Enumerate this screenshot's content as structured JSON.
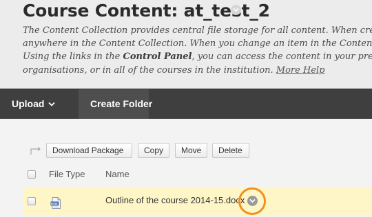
{
  "header": {
    "title": "Course Content: at_test_2",
    "description": {
      "line1": "The Content Collection provides central file storage for all content. When creating",
      "line2": "anywhere in the Content Collection. When you change an item in the Content Colle",
      "line3_pre": "Using the links in the ",
      "line3_bold": "Control Panel",
      "line3_post": ", you can access the content in your present",
      "line4": "organisations, or in all of the courses in the institution. ",
      "help_link": "More Help"
    }
  },
  "toolbar": {
    "upload_label": "Upload",
    "create_folder_label": "Create Folder"
  },
  "actions": {
    "download_package": "Download Package",
    "copy": "Copy",
    "move": "Move",
    "delete": "Delete"
  },
  "table": {
    "columns": [
      "File Type",
      "Name"
    ],
    "rows": [
      {
        "name": "Outline of the course 2014-15.docx",
        "file_type_icon": "doc-icon"
      }
    ]
  },
  "colors": {
    "header_bg": "#ececec",
    "toolbar_bg": "#3f3f3f",
    "highlight_row": "#fff6c8",
    "highlight_ring": "#f0901e"
  }
}
